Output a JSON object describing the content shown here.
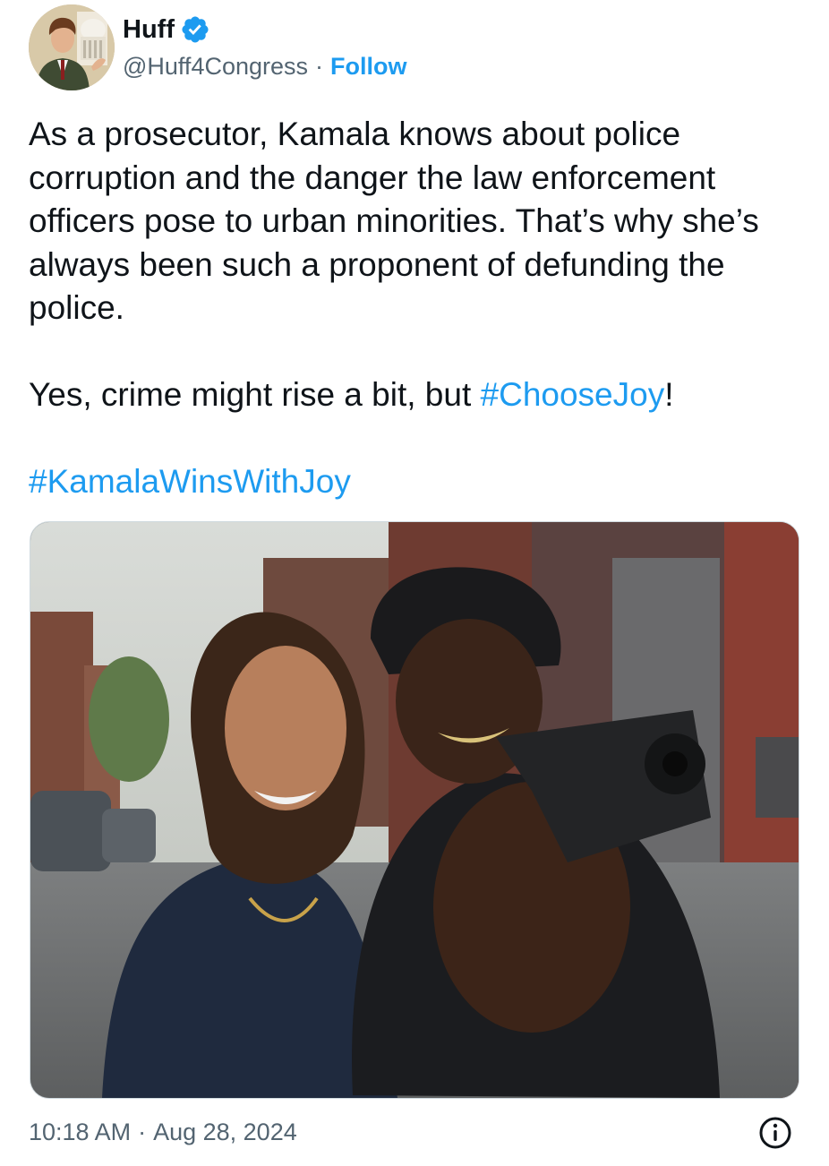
{
  "author": {
    "display_name": "Huff",
    "handle": "@Huff4Congress",
    "separator": "·",
    "follow_label": "Follow",
    "verified": true,
    "avatar_icon": "avatar-portrait"
  },
  "tweet": {
    "paragraph_1": "As a prosecutor, Kamala knows about police corruption and the danger the law enforcement officers pose to urban minorities. That’s why she’s always been such a proponent of defunding the police.",
    "paragraph_2_prefix": "Yes, crime might rise a bit, but ",
    "hashtag_1": "#ChooseJoy",
    "paragraph_2_suffix": "!",
    "hashtag_2": "#KamalaWinsWithJoy"
  },
  "media": {
    "kind": "photo",
    "description_icon": "photo"
  },
  "meta": {
    "time": "10:18 AM",
    "separator": "·",
    "date": "Aug 28, 2024",
    "info_icon": "info-icon"
  },
  "colors": {
    "link": "#1d9bf0",
    "text": "#0f1419",
    "secondary": "#536471",
    "border": "#cfd9de"
  }
}
